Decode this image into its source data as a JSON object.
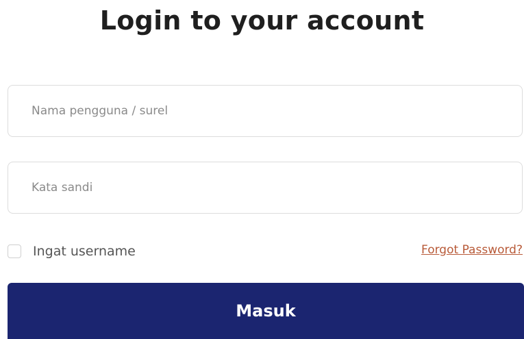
{
  "form": {
    "title": "Login to your account",
    "username": {
      "value": "",
      "placeholder": "Nama pengguna / surel"
    },
    "password": {
      "value": "",
      "placeholder": "Kata sandi"
    },
    "remember": {
      "label": "Ingat username",
      "checked": false
    },
    "forgot_label": "Forgot Password?",
    "submit_label": "Masuk"
  },
  "colors": {
    "primary": "#1b2570",
    "link": "#b85a38",
    "border": "#dcdcdc"
  }
}
